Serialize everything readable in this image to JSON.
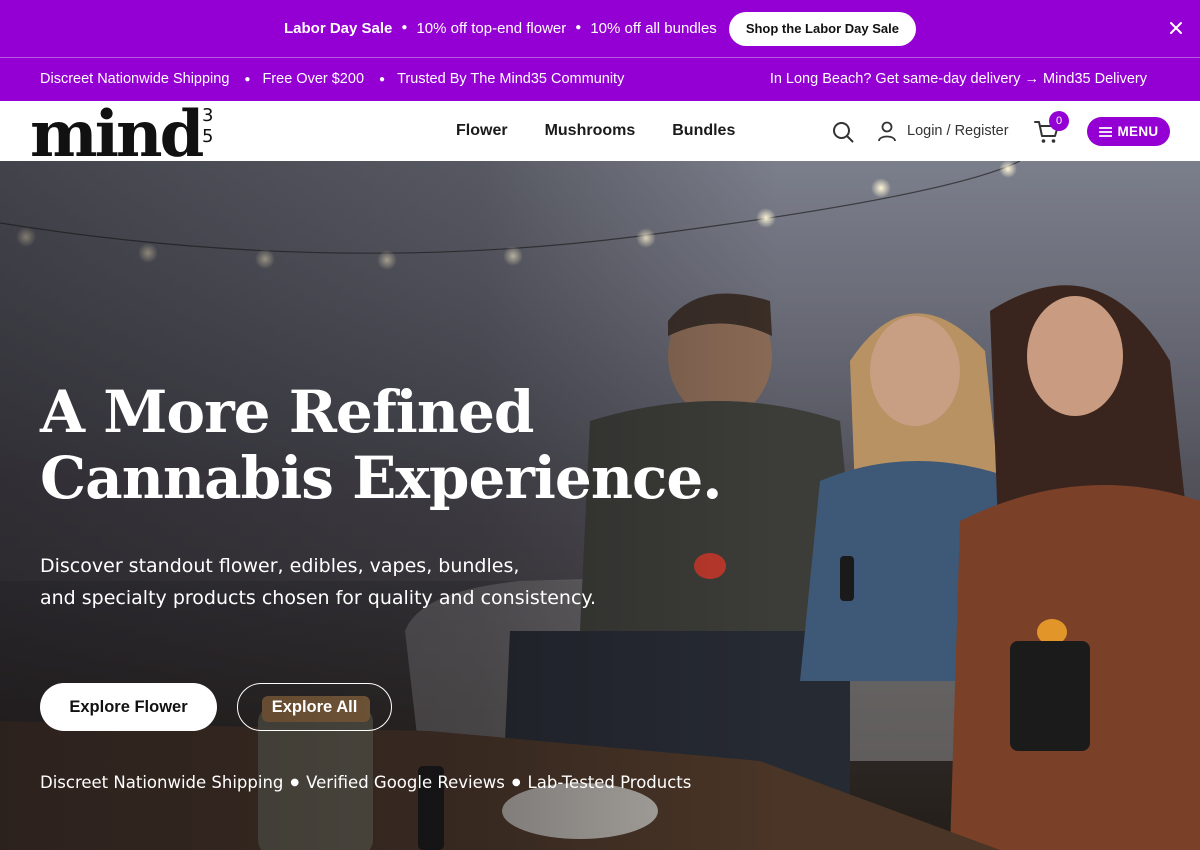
{
  "promo": {
    "sale_name": "Labor Day Sale",
    "offer_1": "10% off top-end flower",
    "offer_2": "10% off all bundles",
    "cta_label": "Shop the Labor Day Sale",
    "close_icon": "close-icon"
  },
  "infobar": {
    "items": [
      "Discreet Nationwide Shipping",
      "Free Over $200",
      "Trusted By The Mind35 Community"
    ],
    "delivery_text": "In Long Beach? Get same-day delivery → Mind35 Delivery"
  },
  "header": {
    "logo_text": "mind",
    "logo_sup_1": "3",
    "logo_sup_2": "5",
    "nav": [
      "Flower",
      "Mushrooms",
      "Bundles"
    ],
    "login_label": "Login / Register",
    "cart_count": "0",
    "menu_label": "MENU"
  },
  "hero": {
    "title_line_1": "A More Refined",
    "title_line_2": "Cannabis Experience.",
    "subtitle_line_1": "Discover standout flower, edibles, vapes, bundles,",
    "subtitle_line_2": "and specialty products chosen for quality and consistency.",
    "primary_cta": "Explore Flower",
    "secondary_cta": "Explore All",
    "trust_items": [
      "Discreet Nationwide Shipping",
      "Verified Google Reviews",
      "Lab-Tested Products"
    ]
  },
  "colors": {
    "brand_purple": "#9400d3",
    "white": "#ffffff"
  }
}
